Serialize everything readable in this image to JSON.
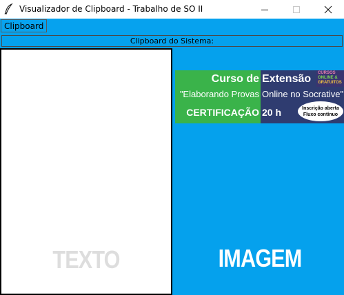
{
  "window": {
    "title": "Visualizador de Clipboard - Trabalho de SO II",
    "icon": "feather-icon",
    "controls": [
      "minimize-icon",
      "maximize-icon",
      "close-icon"
    ]
  },
  "menubar": {
    "items": [
      {
        "label": "Clipboard"
      }
    ]
  },
  "header": {
    "label": "Clipboard do Sistema:"
  },
  "text_panel": {
    "placeholder_label": "TEXTO"
  },
  "image_panel": {
    "placeholder_label": "IMAGEM",
    "banner": {
      "line1_left": "Curso de",
      "line1_right": "Extensão",
      "line2_left": "\"Elaborando Provas",
      "line2_right": "Online no Socrative\"",
      "line3_left": "CERTIFICAÇÃO",
      "line3_right": "20 h",
      "badge": [
        "CURSOS",
        "ONLINE &",
        "GRATUITOS"
      ],
      "oval": [
        "Inscrição aberta",
        "Fluxo contínuo"
      ]
    }
  },
  "colors": {
    "accent": "#05a1ed",
    "banner_green": "#3ab34a",
    "banner_dark": "#2f3c70"
  }
}
